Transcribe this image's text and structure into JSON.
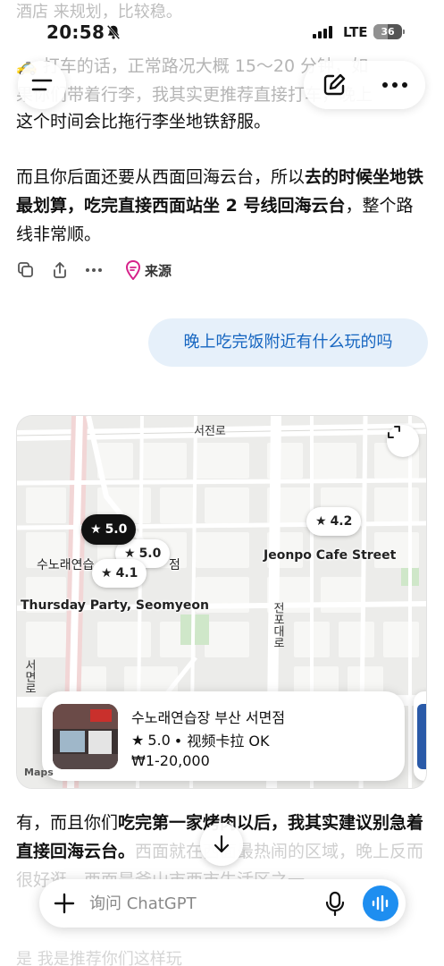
{
  "status_bar": {
    "time": "20:58",
    "network": "LTE",
    "battery": "36"
  },
  "top_fragment": "酒店 来规划，比较稳。",
  "messages": {
    "taxi_para_faded_1": "🚕 打车的话，正常路况大概 15～20 分钟，如",
    "taxi_para_faded_2": "果你们带着行李，我其实更推荐直接打车，晚上",
    "taxi_para_line3": "这个时间会比拖行李坐地铁舒服。",
    "subway_para_plain1": "而且你后面还要从西面回海云台，所以",
    "subway_para_bold1": "去的时候坐地铁最划算，吃完直接西面站坐 2 号线回海云台",
    "subway_para_plain2": "，整个路线非常顺。",
    "action_source_label": "来源",
    "user_message": "晚上吃完饭附近有什么玩的吗",
    "reply_plain1": "有，而且你们",
    "reply_bold1": "吃完第一家烤肉以后，我其实建议别急着直接回海云台。",
    "reply_plain2": "西面就在西面最热闹的区域，晚上反而很好逛，西面是釜山市西市生活区之一",
    "bottom_fragment": "是 我是推荐你们这样玩"
  },
  "map": {
    "street_labels": {
      "seojeon_ro": "서전로",
      "jeonpo_daero": "전포대로",
      "seomyeon_ro": "서면로"
    },
    "places": {
      "jeonpo_cafe": "Jeonpo Cafe Street",
      "thursday_party": "Thursday Party, Seomyeon",
      "sunorae_partial_left": "수노래연습",
      "sunorae_partial_right": "점"
    },
    "ratings": {
      "selected": "5.0",
      "second": "5.0",
      "third": "4.1",
      "jeonpo": "4.2"
    },
    "attribution": "Maps",
    "place_card": {
      "title": "수노래연습장 부산 서면점",
      "rating": "5.0",
      "category": "• 视频卡拉 OK",
      "price": "₩1-20,000"
    }
  },
  "composer": {
    "placeholder": "询问 ChatGPT"
  },
  "colors": {
    "accent": "#1e8ef0",
    "user_bubble": "#e6f0fa",
    "user_text": "#1565c0",
    "source_icon": "#d6218a"
  },
  "icons": [
    "menu-icon",
    "new-chat-icon",
    "more-icon",
    "copy-icon",
    "share-icon",
    "more-horizontal-icon",
    "source-icon",
    "expand-icon",
    "star-icon",
    "scroll-down-icon",
    "plus-icon",
    "microphone-icon",
    "voice-mode-icon"
  ]
}
